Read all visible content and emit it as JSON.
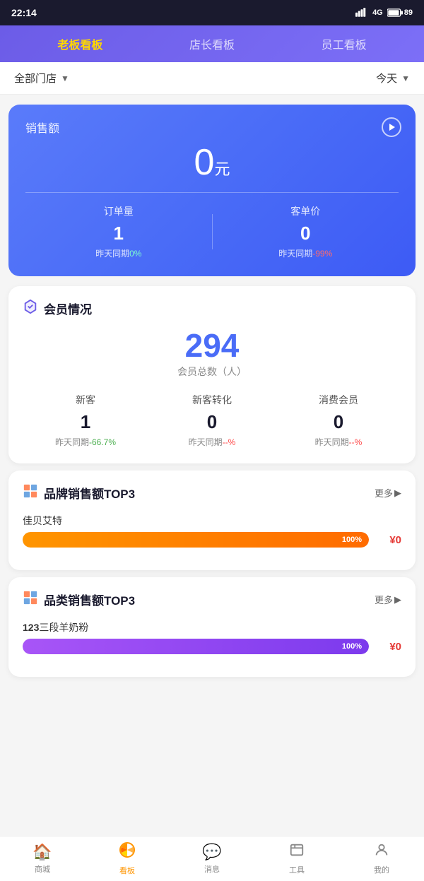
{
  "statusBar": {
    "time": "22:14",
    "network": "HD 4G",
    "battery": "89"
  },
  "navTabs": {
    "tabs": [
      {
        "id": "boss",
        "label": "老板看板",
        "active": true
      },
      {
        "id": "manager",
        "label": "店长看板",
        "active": false
      },
      {
        "id": "staff",
        "label": "员工看板",
        "active": false
      }
    ]
  },
  "filterBar": {
    "storeLabel": "全部门店",
    "dateLabel": "今天"
  },
  "salesCard": {
    "title": "销售额",
    "amount": "0",
    "unit": "元",
    "orderCount": {
      "label": "订单量",
      "value": "1",
      "compareLabel": "昨天同期",
      "compareValue": "0%",
      "compareClass": "green"
    },
    "unitPrice": {
      "label": "客单价",
      "value": "0",
      "compareLabel": "昨天同期",
      "compareValue": "-99%",
      "compareClass": "red"
    }
  },
  "memberSection": {
    "title": "会员情况",
    "totalCount": "294",
    "totalLabel": "会员总数（人）",
    "stats": [
      {
        "label": "新客",
        "value": "1",
        "compareLabel": "昨天同期",
        "compareValue": "-66.7%",
        "compareClass": "green"
      },
      {
        "label": "新客转化",
        "value": "0",
        "compareLabel": "昨天同期",
        "compareValue": "--%",
        "compareClass": "red"
      },
      {
        "label": "消费会员",
        "value": "0",
        "compareLabel": "昨天同期",
        "compareValue": "--%",
        "compareClass": "red"
      }
    ]
  },
  "brandTop3": {
    "title": "品牌销售额TOP3",
    "moreLabel": "更多",
    "items": [
      {
        "name": "佳贝艾特",
        "pct": 100,
        "pctLabel": "100%",
        "amount": "¥0",
        "barClass": "orange"
      }
    ]
  },
  "categoryTop3": {
    "title": "品类销售额TOP3",
    "moreLabel": "更多",
    "items": [
      {
        "nameHighlight": "123",
        "nameRest": "三段羊奶粉",
        "pct": 100,
        "pctLabel": "100%",
        "amount": "¥0",
        "barClass": "purple"
      }
    ]
  },
  "bottomNav": {
    "items": [
      {
        "id": "store",
        "icon": "🏠",
        "label": "商城",
        "active": false
      },
      {
        "id": "dashboard",
        "icon": "📊",
        "label": "看板",
        "active": true
      },
      {
        "id": "message",
        "icon": "💬",
        "label": "消息",
        "active": false
      },
      {
        "id": "tools",
        "icon": "🧰",
        "label": "工具",
        "active": false
      },
      {
        "id": "mine",
        "icon": "👤",
        "label": "我的",
        "active": false
      }
    ]
  }
}
